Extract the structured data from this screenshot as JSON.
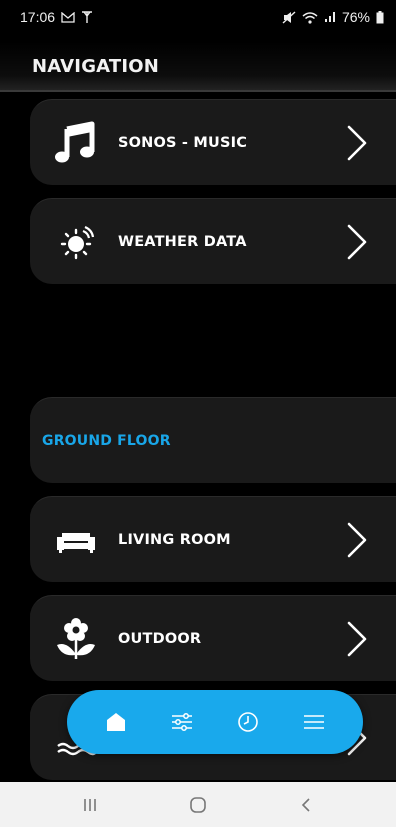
{
  "status_bar": {
    "time": "17:06",
    "battery": "76%",
    "left_icons": [
      "gmail-icon",
      "antenna-icon"
    ],
    "right_icons": [
      "mute-icon",
      "wifi-icon",
      "signal-icon",
      "battery-icon"
    ]
  },
  "header": {
    "title": "NAVIGATION"
  },
  "items": [
    {
      "label": "SONOS - MUSIC",
      "icon": "music-note-icon"
    },
    {
      "label": "WEATHER DATA",
      "icon": "sun-icon"
    }
  ],
  "section": {
    "label": "GROUND FLOOR"
  },
  "rooms": [
    {
      "label": "LIVING ROOM",
      "icon": "sofa-icon"
    },
    {
      "label": "OUTDOOR",
      "icon": "flower-icon"
    },
    {
      "label": "",
      "icon": "pool-icon"
    }
  ],
  "bottom_nav": {
    "items": [
      "home-icon",
      "sliders-icon",
      "clock-icon",
      "menu-icon"
    ],
    "active": "home-icon"
  },
  "colors": {
    "accent": "#19a9ec",
    "card": "#1a1a1a",
    "background": "#000000"
  }
}
